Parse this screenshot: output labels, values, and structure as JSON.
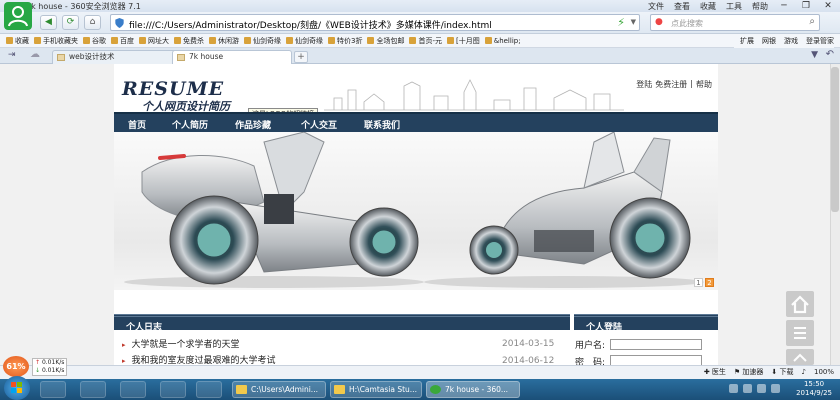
{
  "window": {
    "title": "7k house - 360安全浏览器 7.1",
    "menu": [
      "文件",
      "查看",
      "收藏",
      "工具",
      "帮助"
    ],
    "controls": [
      "─",
      "❐",
      "✕"
    ]
  },
  "address": {
    "url": "file:///C:/Users/Administrator/Desktop/刻盘/《WEB设计技术》多媒体课件/index.html",
    "search_placeholder": "点此搜索"
  },
  "bookmarks": {
    "items": [
      "收藏",
      "手机收藏夹",
      "谷歌",
      "百度",
      "网址大",
      "免费杀",
      "休闲游",
      "仙剑奇缘",
      "仙剑奇缘",
      "特价3折",
      "全场包邮",
      "首页-元",
      "[十月图",
      "&hellip;"
    ],
    "right": [
      "扩展",
      "网银",
      "游戏",
      "登录管家"
    ]
  },
  "tabs": [
    {
      "label": "web设计技术"
    },
    {
      "label": "7k house"
    }
  ],
  "page": {
    "logo_text": "RESUME",
    "subtitle": "个人网页设计简历",
    "tooltip": "这是LOGO的超链接",
    "top_links": [
      "登陆",
      "免费注册",
      "帮助"
    ],
    "nav": [
      "首页",
      "个人简历",
      "作品珍藏",
      "个人交互",
      "联系我们"
    ],
    "pager": [
      "1",
      "2"
    ],
    "sections": {
      "log_title": "个人日志",
      "login_title": "个人登陆"
    },
    "log_entries": [
      {
        "title": "大学就是一个求学者的天堂",
        "date": "2014-03-15"
      },
      {
        "title": "我和我的室友度过最艰难的大学考试",
        "date": "2014-06-12"
      }
    ],
    "login": {
      "username_label": "用户名:",
      "password_label": "密　码:"
    }
  },
  "statusbar": {
    "items": [
      "医生",
      "加速器",
      "下载",
      "100%"
    ],
    "net_percent": "61%",
    "net_up": "0.01K/s",
    "net_down": "0.01K/s"
  },
  "taskbar": {
    "tasks": [
      "C:\\Users\\Admini...",
      "H:\\Camtasia Stu...",
      "7k house - 360..."
    ],
    "time": "15:50",
    "date": "2014/9/25"
  }
}
